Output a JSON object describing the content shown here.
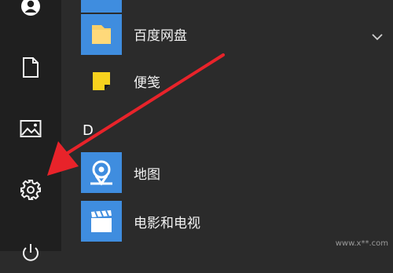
{
  "rail": {
    "items": [
      {
        "icon": "user-icon"
      },
      {
        "icon": "document-icon"
      },
      {
        "icon": "pictures-icon"
      },
      {
        "icon": "gear-icon"
      },
      {
        "icon": "power-icon"
      }
    ]
  },
  "apps": [
    {
      "label": "百度网盘",
      "icon": "folder-icon",
      "tile_color": "#3f8ddf"
    },
    {
      "label": "便笺",
      "icon": "sticky-note-icon",
      "tile_color": "#2b2b2b"
    },
    {
      "label": "地图",
      "icon": "map-pin-icon",
      "tile_color": "#3f8ddf"
    },
    {
      "label": "电影和电视",
      "icon": "clapperboard-icon",
      "tile_color": "#3f8ddf"
    }
  ],
  "section_letter": "D",
  "expand_icon": "chevron-down-icon",
  "annotation": {
    "arrow_color": "#e8232a",
    "target": "settings-gear"
  },
  "watermark_text": "www.x**.com"
}
